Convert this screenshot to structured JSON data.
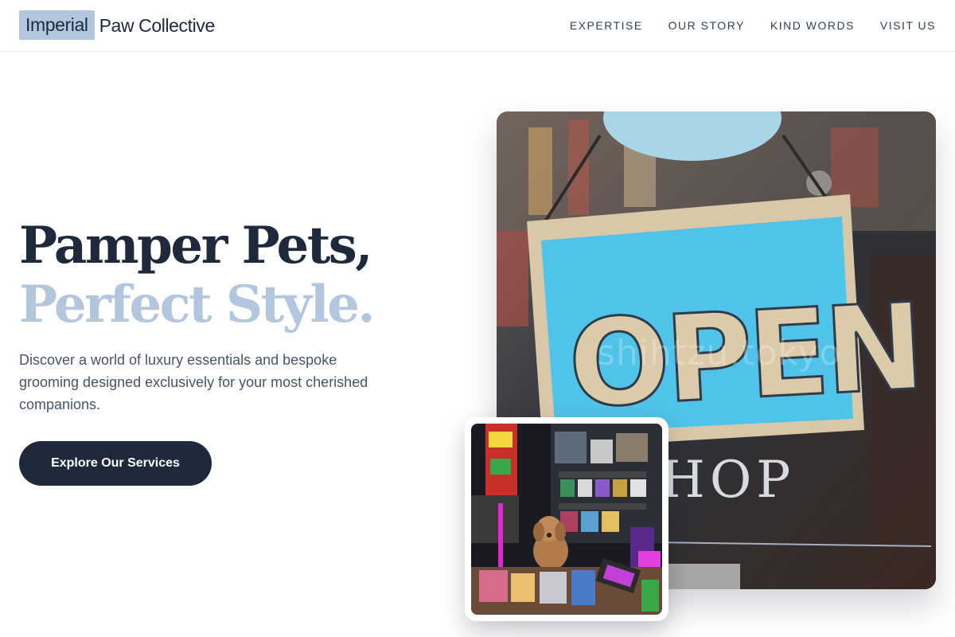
{
  "brand": {
    "highlight": "Imperial",
    "rest": "Paw Collective"
  },
  "nav": {
    "items": [
      {
        "label": "EXPERTISE"
      },
      {
        "label": "OUR STORY"
      },
      {
        "label": "KIND WORDS"
      },
      {
        "label": "VISIT US"
      }
    ]
  },
  "hero": {
    "title_line1": "Pamper Pets,",
    "title_line2": "Perfect Style.",
    "description": "Discover a world of luxury essentials and bespoke grooming designed exclusively for your most cherished companions.",
    "cta_label": "Explore Our Services"
  },
  "photos": {
    "main": {
      "sign_text": "OPEN",
      "shop_text": "HOP",
      "watermark": "shihtzu.tokyo"
    }
  },
  "colors": {
    "primary": "#1e293b",
    "accent": "#b2c6dd",
    "text_muted": "#475569",
    "sign_blue": "#4fc3e8"
  }
}
